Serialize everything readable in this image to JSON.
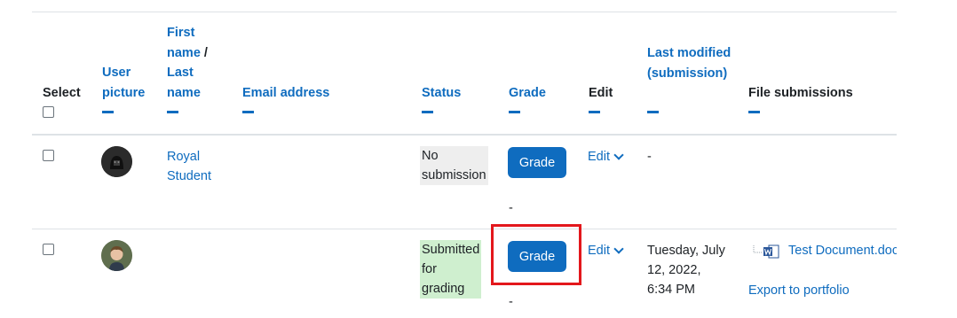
{
  "headers": {
    "select": "Select",
    "user_picture": "User picture",
    "first_name": "First name",
    "slash": " / ",
    "last_name": "Last name",
    "email": "Email address",
    "status": "Status",
    "grade": "Grade",
    "edit": "Edit",
    "last_modified": "Last modified (submission)",
    "file_submissions": "File submissions"
  },
  "rows": [
    {
      "name_line1": "Royal",
      "name_line2": "Student",
      "status_line1": "No",
      "status_line2": "submission",
      "grade_button": "Grade",
      "grade_below": "-",
      "edit": "Edit",
      "last_modified": "-"
    },
    {
      "status_line1": "Submitted",
      "status_line2": "for",
      "status_line3": "grading",
      "grade_button": "Grade",
      "grade_below": "-",
      "edit": "Edit",
      "last_modified_line1": "Tuesday, July",
      "last_modified_line2": "12, 2022,",
      "last_modified_line3": "6:34 PM",
      "file_name": "Test Document.doc",
      "export": "Export to portfolio"
    }
  ],
  "colors": {
    "link": "#0f6cbf",
    "highlight": "#e3171c",
    "status_submitted_bg": "#cfefcf",
    "status_none_bg": "#eeeeee"
  }
}
